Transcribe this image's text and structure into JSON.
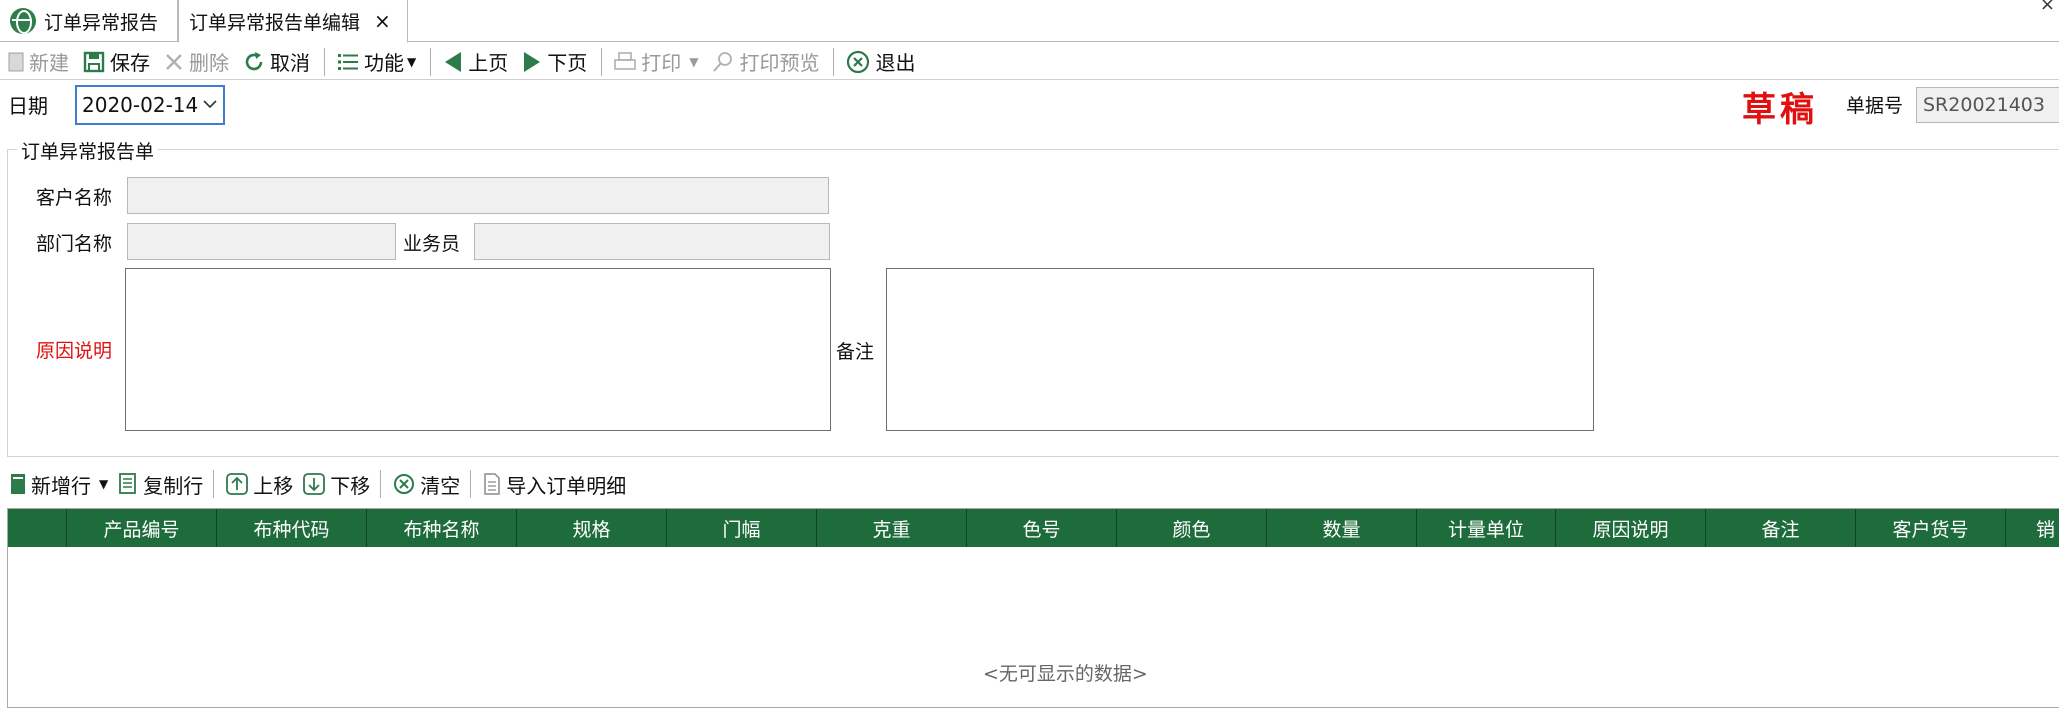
{
  "tabs": [
    {
      "label": "订单异常报告",
      "icon": "globe-icon"
    },
    {
      "label": "订单异常报告单编辑",
      "close": "×"
    }
  ],
  "window_close": "×",
  "toolbar": {
    "new": "新建",
    "save": "保存",
    "delete": "删除",
    "cancel": "取消",
    "function": "功能",
    "prev": "上页",
    "next": "下页",
    "print": "打印",
    "print_preview": "打印预览",
    "exit": "退出"
  },
  "header": {
    "date_label": "日期",
    "date_value": "2020-02-14",
    "status": "草稿",
    "docno_label": "单据号",
    "docno_value": "SR20021403"
  },
  "form": {
    "group_title": "订单异常报告单",
    "customer_label": "客户名称",
    "customer_value": "",
    "dept_label": "部门名称",
    "dept_value": "",
    "salesman_label": "业务员",
    "salesman_value": "",
    "reason_label": "原因说明",
    "reason_value": "",
    "remark_label": "备注",
    "remark_value": ""
  },
  "detail_toolbar": {
    "add_row": "新增行",
    "copy_row": "复制行",
    "move_up": "上移",
    "move_down": "下移",
    "clear": "清空",
    "import": "导入订单明细"
  },
  "grid": {
    "columns": [
      "产品编号",
      "布种代码",
      "布种名称",
      "规格",
      "门幅",
      "克重",
      "色号",
      "颜色",
      "数量",
      "计量单位",
      "原因说明",
      "备注",
      "客户货号",
      "销"
    ],
    "empty_text": "<无可显示的数据>"
  },
  "colors": {
    "grid_header": "#1e6b3c",
    "status_red": "#e01010",
    "required_label": "#e01010",
    "focus_border": "#3c7ed0"
  }
}
